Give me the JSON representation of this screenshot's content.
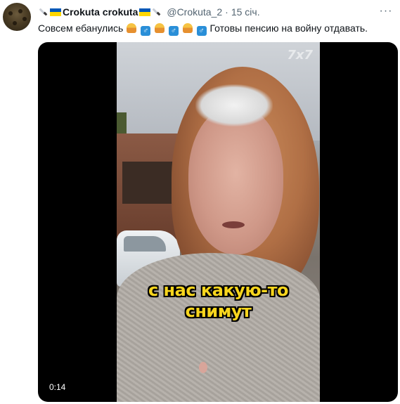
{
  "tweet": {
    "display_name": "Crokuta crokuta",
    "handle": "@Crokuta_2",
    "separator": "·",
    "time": "15 січ.",
    "text_parts": [
      "Совсем ебанулись",
      "Готовы пенсию на войну отдавать."
    ],
    "emoji_sequence": [
      "person-emoji",
      "male-sign-emoji",
      "person-emoji",
      "male-sign-emoji",
      "person-emoji",
      "male-sign-emoji"
    ],
    "more_label": "···"
  },
  "media": {
    "watermark": "7x7",
    "subtitle_lines": [
      "с нас какую-то",
      "снимут"
    ],
    "duration": "0:14"
  },
  "colors": {
    "subtitle": "#f7d51d",
    "flag_blue": "#0057b7",
    "flag_yellow": "#ffd700",
    "secondary_text": "#536471"
  }
}
